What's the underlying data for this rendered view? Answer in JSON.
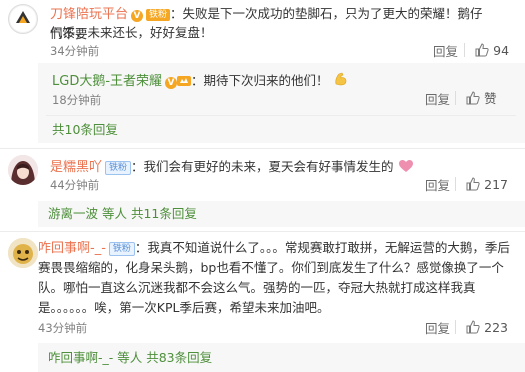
{
  "comments": [
    {
      "author": "刀锋陪玩平台",
      "verified_badge": "V",
      "level_badge": "铁粉",
      "separator": "：",
      "text_line1": "失败是下一次成功的垫脚石，只为了更大的荣耀！鹅仔们不要",
      "text_line2": "气馁，未来还长，好好复盘！",
      "time": "34分钟前",
      "reply_label": "回复",
      "likes": "94",
      "replies": [
        {
          "author": "LGD大鹅-王者荣耀",
          "verified_badge": "V",
          "separator": "：",
          "text": "期待下次归来的他们！",
          "emoji": "flexed-biceps",
          "time": "18分钟前",
          "reply_label": "回复",
          "like_label": "赞"
        }
      ],
      "total_replies": "共10条回复"
    },
    {
      "author": "是糯黑吖",
      "level_badge": "铁粉",
      "separator": "：",
      "text": "我们会有更好的未来，夏天会有好事情发生的",
      "emoji": "pink-heart",
      "time": "44分钟前",
      "reply_label": "回复",
      "likes": "217",
      "reply_summary": "游离一波 等人 共11条回复"
    },
    {
      "author": "咋回事啊-_-",
      "level_badge": "铁粉",
      "separator": "：",
      "text_line1": "我真不知道说什么了。。。常规赛敢打敢拼，无解运营的大鹅，季后",
      "text_line2": "赛畏畏缩缩的，化身呆头鹅，bp也看不懂了。你们到底发生了什么？感觉像换了一个",
      "text_line3": "队。哪怕一直这么沉迷我都不会这么气。强势的一匹，夺冠大热就打成这样我真",
      "text_line4": "是。。。。。。唉，第一次KPL季后赛，希望未来加油吧。",
      "time": "43分钟前",
      "reply_label": "回复",
      "likes": "223",
      "reply_summary": "咋回事啊-_- 等人 共83条回复"
    }
  ],
  "colors": {
    "author": "#eb7350",
    "link": "#4d8f3a",
    "meta": "#808080",
    "nested_bg": "#f7f7f7",
    "badge_gold": "#f5a623"
  }
}
